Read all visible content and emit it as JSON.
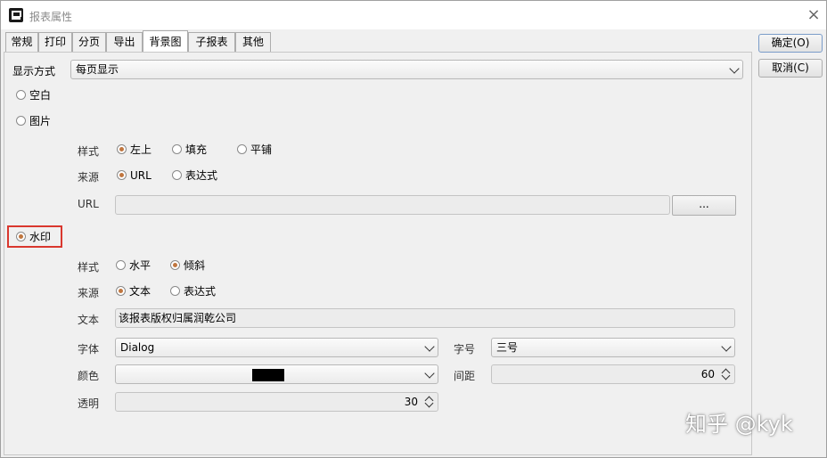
{
  "window": {
    "title": "报表属性",
    "close_icon": "×"
  },
  "tabs": [
    "常规",
    "打印",
    "分页",
    "导出",
    "背景图",
    "子报表",
    "其他"
  ],
  "buttons": {
    "ok": "确定(O)",
    "cancel": "取消(C)"
  },
  "display": {
    "label": "显示方式",
    "value": "每页显示"
  },
  "options": {
    "blank": "空白",
    "image": "图片",
    "watermark": "水印",
    "selected": "水印"
  },
  "image": {
    "style_label": "样式",
    "style_options": [
      "左上",
      "填充",
      "平铺"
    ],
    "style_selected": "左上",
    "source_label": "来源",
    "source_options": [
      "URL",
      "表达式"
    ],
    "source_selected": "URL",
    "url_label": "URL",
    "url_value": "",
    "browse_label": "..."
  },
  "watermark": {
    "style_label": "样式",
    "style_options": [
      "水平",
      "倾斜"
    ],
    "style_selected": "倾斜",
    "source_label": "来源",
    "source_options": [
      "文本",
      "表达式"
    ],
    "source_selected": "文本",
    "text_label": "文本",
    "text_value": "该报表版权归属润乾公司",
    "font_label": "字体",
    "font_value": "Dialog",
    "size_label": "字号",
    "size_value": "三号",
    "color_label": "颜色",
    "color_value": "#000000",
    "spacing_label": "间距",
    "spacing_value": "60",
    "opacity_label": "透明",
    "opacity_value": "30"
  },
  "overlay_watermark": "知乎 @kyk"
}
